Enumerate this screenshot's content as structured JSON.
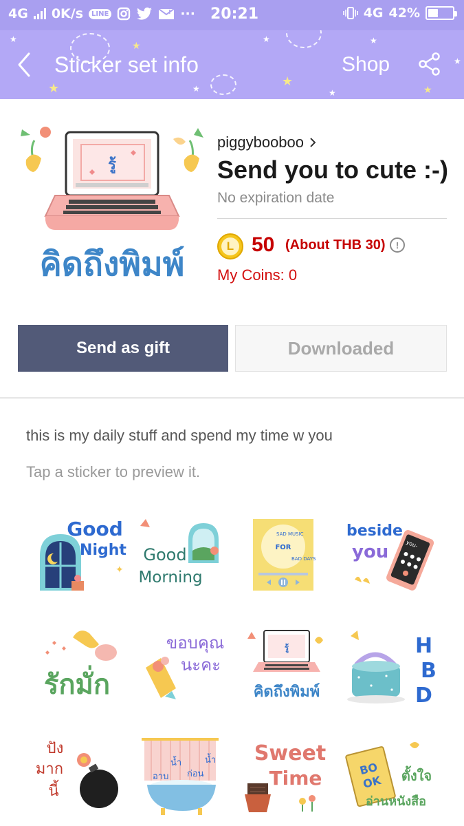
{
  "status_bar": {
    "network_left": "4G",
    "speed": "0K/s",
    "line_badge": "LINE",
    "time": "20:21",
    "dots": "···",
    "network_right": "4G",
    "battery_percent": "42%",
    "battery_level": 0.42,
    "icons": [
      "signal-icon",
      "line-icon",
      "instagram-icon",
      "twitter-icon",
      "mail-icon",
      "vibrate-icon",
      "battery-icon"
    ]
  },
  "header": {
    "title": "Sticker set info",
    "shop_label": "Shop",
    "back_icon": "chevron-left-icon",
    "share_icon": "share-icon",
    "color": "#b3a8f6"
  },
  "set_info": {
    "cover_text": "คิดถึงพิมพ์",
    "author": "piggybooboo",
    "name": "Send you to cute :-)",
    "expiration": "No expiration date",
    "coin_letter": "L",
    "price": "50",
    "price_about": "(About THB 30)",
    "my_coins": "My Coins: 0",
    "price_color": "#c60000"
  },
  "actions": {
    "send_gift": "Send as gift",
    "downloaded": "Downloaded",
    "gift_color": "#525a78"
  },
  "description": "this is my daily stuff and spend my time w you",
  "preview_hint": "Tap a sticker to preview it.",
  "stickers": [
    {
      "lines": [
        "Good",
        "Night"
      ]
    },
    {
      "lines": [
        "Good",
        "Morning"
      ]
    },
    {
      "lines": [
        "SAD MUSIC",
        "FOR",
        "BAD DAYS"
      ]
    },
    {
      "lines": [
        "beside",
        "you",
        "you-"
      ]
    },
    {
      "lines": [
        "รักมั่ก"
      ]
    },
    {
      "lines": [
        "ขอบคุณ",
        "นะคะ"
      ]
    },
    {
      "lines": [
        "รู้",
        "คิดถึงพิมพ์"
      ]
    },
    {
      "lines": [
        "H",
        "B",
        "D"
      ]
    },
    {
      "lines": [
        "ปัง",
        "มาก",
        "นี้"
      ]
    },
    {
      "lines": [
        "อาบ",
        "น้ำ",
        "ก่อน",
        "น้ำ"
      ]
    },
    {
      "lines": [
        "Sweet",
        "Time"
      ]
    },
    {
      "lines": [
        "BO",
        "OK",
        "ตั้งใจ",
        "อ่านหนังสือ"
      ]
    }
  ]
}
